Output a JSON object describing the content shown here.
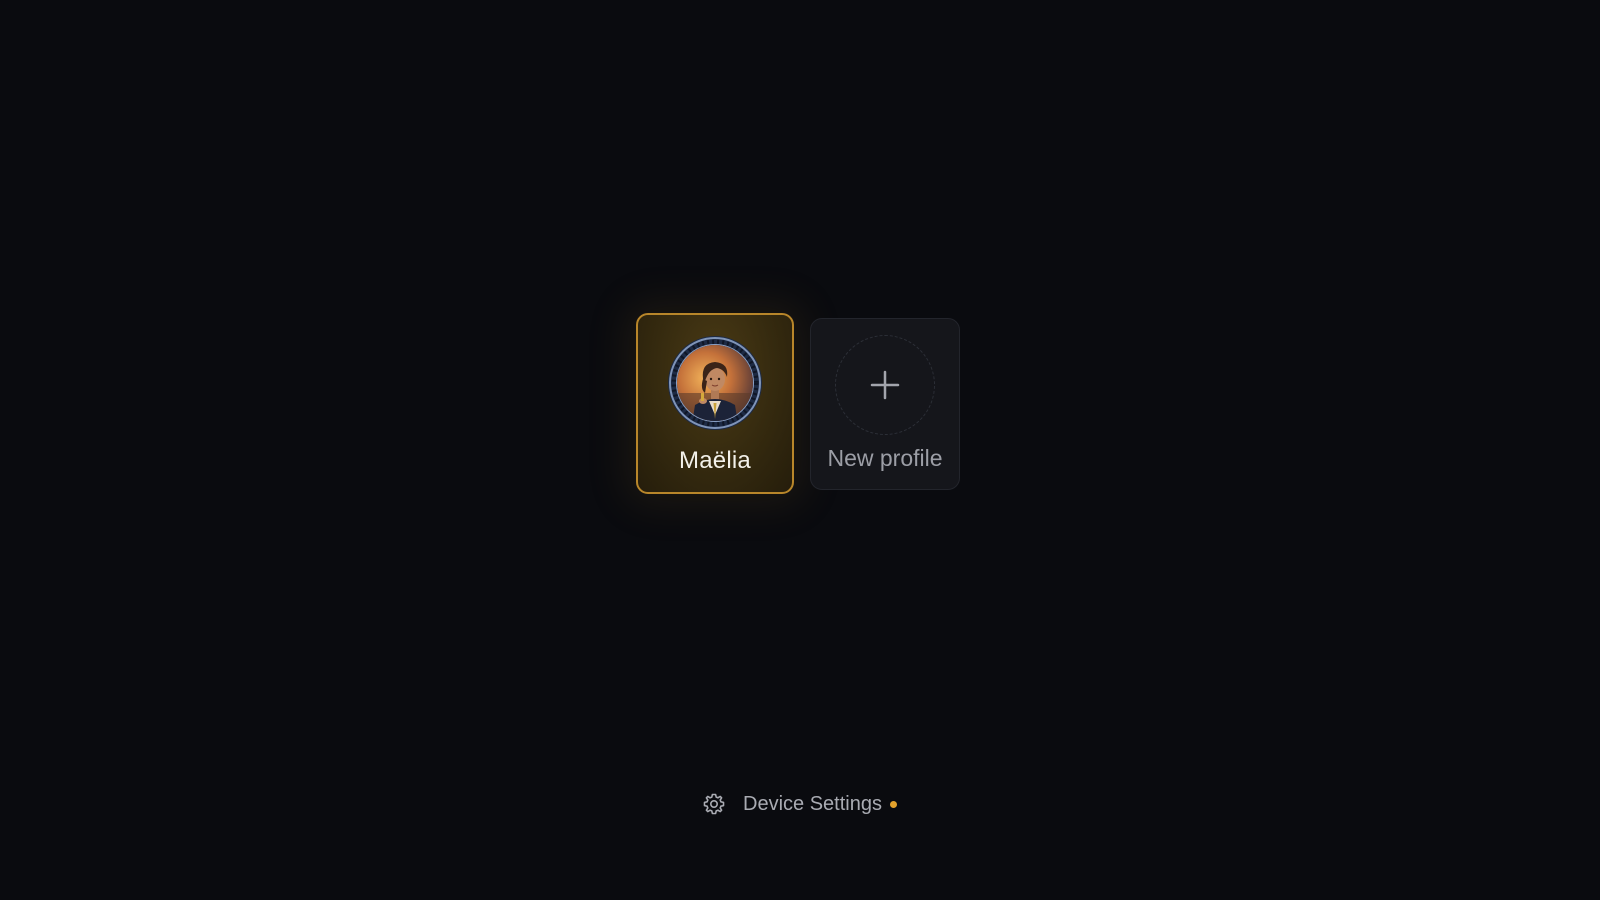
{
  "profiles": [
    {
      "name": "Maëlia",
      "selected": true,
      "avatar": "illustrated-portrait"
    }
  ],
  "new_profile": {
    "label": "New profile",
    "icon": "plus-icon"
  },
  "footer": {
    "settings_label": "Device Settings",
    "settings_icon": "gear-icon",
    "has_notification": true
  },
  "colors": {
    "background": "#0a0b0f",
    "accent": "#b8862a",
    "notification": "#e3a22c",
    "card": "#15161b",
    "text_primary": "#f3f1ea",
    "text_secondary": "#9c9ea6"
  }
}
